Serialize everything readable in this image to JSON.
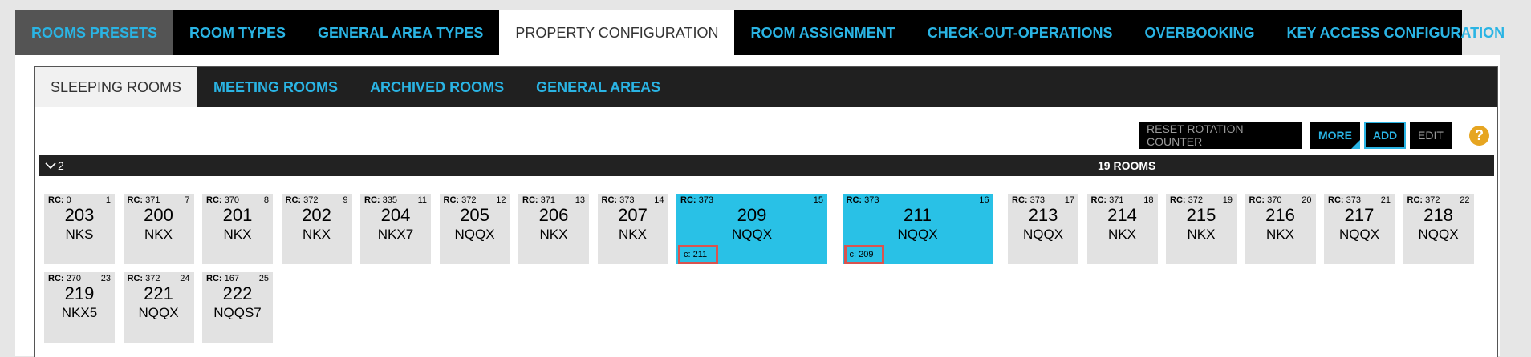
{
  "top_tabs": [
    {
      "label": "ROOMS PRESETS"
    },
    {
      "label": "ROOM TYPES"
    },
    {
      "label": "GENERAL AREA TYPES"
    },
    {
      "label": "PROPERTY CONFIGURATION"
    },
    {
      "label": "ROOM ASSIGNMENT"
    },
    {
      "label": "CHECK-OUT-OPERATIONS"
    },
    {
      "label": "OVERBOOKING"
    },
    {
      "label": "KEY ACCESS CONFIGURATION"
    }
  ],
  "sub_tabs": [
    {
      "label": "SLEEPING ROOMS"
    },
    {
      "label": "MEETING ROOMS"
    },
    {
      "label": "ARCHIVED ROOMS"
    },
    {
      "label": "GENERAL AREAS"
    }
  ],
  "toolbar": {
    "reset_label": "RESET ROTATION COUNTER",
    "more_label": "MORE",
    "add_label": "ADD",
    "edit_label": "EDIT",
    "help_label": "?"
  },
  "group": {
    "label": "2",
    "count_label": "19 ROOMS"
  },
  "rc_prefix": "RC:",
  "conn_prefix": "c:",
  "rooms": [
    {
      "rc": "0",
      "idx": "1",
      "number": "203",
      "type": "NKS"
    },
    {
      "rc": "371",
      "idx": "7",
      "number": "200",
      "type": "NKX"
    },
    {
      "rc": "370",
      "idx": "8",
      "number": "201",
      "type": "NKX"
    },
    {
      "rc": "372",
      "idx": "9",
      "number": "202",
      "type": "NKX"
    },
    {
      "rc": "335",
      "idx": "11",
      "number": "204",
      "type": "NKX7"
    },
    {
      "rc": "372",
      "idx": "12",
      "number": "205",
      "type": "NQQX"
    },
    {
      "rc": "371",
      "idx": "13",
      "number": "206",
      "type": "NKX"
    },
    {
      "rc": "373",
      "idx": "14",
      "number": "207",
      "type": "NKX"
    },
    {
      "rc": "373",
      "idx": "15",
      "number": "209",
      "type": "NQQX",
      "connected": "211"
    },
    {
      "rc": "373",
      "idx": "16",
      "number": "211",
      "type": "NQQX",
      "connected": "209"
    },
    {
      "rc": "373",
      "idx": "17",
      "number": "213",
      "type": "NQQX"
    },
    {
      "rc": "371",
      "idx": "18",
      "number": "214",
      "type": "NKX"
    },
    {
      "rc": "372",
      "idx": "19",
      "number": "215",
      "type": "NKX"
    },
    {
      "rc": "370",
      "idx": "20",
      "number": "216",
      "type": "NKX"
    },
    {
      "rc": "373",
      "idx": "21",
      "number": "217",
      "type": "NQQX"
    },
    {
      "rc": "372",
      "idx": "22",
      "number": "218",
      "type": "NQQX"
    },
    {
      "rc": "270",
      "idx": "23",
      "number": "219",
      "type": "NKX5"
    },
    {
      "rc": "372",
      "idx": "24",
      "number": "221",
      "type": "NQQX"
    },
    {
      "rc": "167",
      "idx": "25",
      "number": "222",
      "type": "NQQS7"
    }
  ],
  "colors": {
    "accent": "#2ab4e4",
    "highlight_room": "#29c1e6",
    "connection_border": "#d9534f",
    "help": "#e6a521"
  }
}
